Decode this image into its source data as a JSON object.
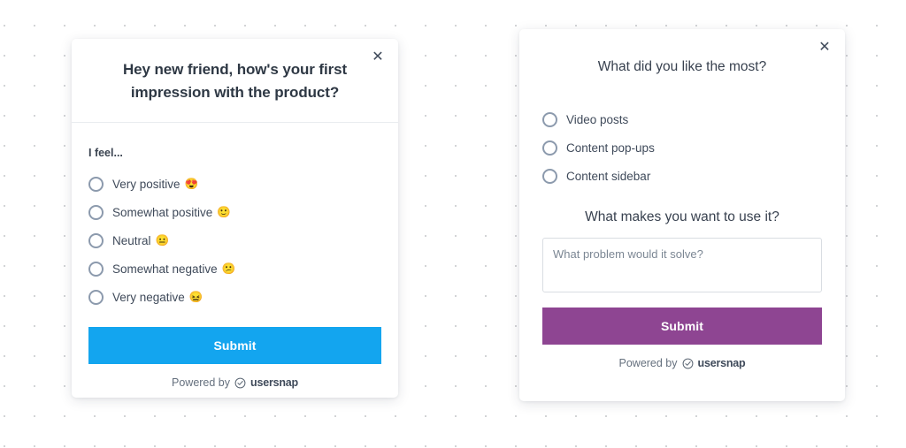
{
  "panel_one": {
    "close_icon": "close-icon",
    "title": "Hey new friend, how's your first impression with the product?",
    "field_label": "I feel...",
    "options": [
      {
        "label": "Very positive",
        "emoji": "😍"
      },
      {
        "label": "Somewhat positive",
        "emoji": "🙂"
      },
      {
        "label": "Neutral",
        "emoji": "😐"
      },
      {
        "label": "Somewhat negative",
        "emoji": "😕"
      },
      {
        "label": "Very negative",
        "emoji": "😖"
      }
    ],
    "submit_label": "Submit",
    "powered_prefix": "Powered by",
    "powered_brand": "usersnap",
    "accent_color": "#13a5ef"
  },
  "panel_two": {
    "close_icon": "close-icon",
    "title": "What did you like the most?",
    "options": [
      {
        "label": "Video posts"
      },
      {
        "label": "Content pop-ups"
      },
      {
        "label": "Content sidebar"
      }
    ],
    "subtitle": "What makes you want to use it?",
    "textarea_placeholder": "What problem would it solve?",
    "textarea_value": "",
    "submit_label": "Submit",
    "powered_prefix": "Powered by",
    "powered_brand": "usersnap",
    "accent_color": "#8e4592"
  }
}
